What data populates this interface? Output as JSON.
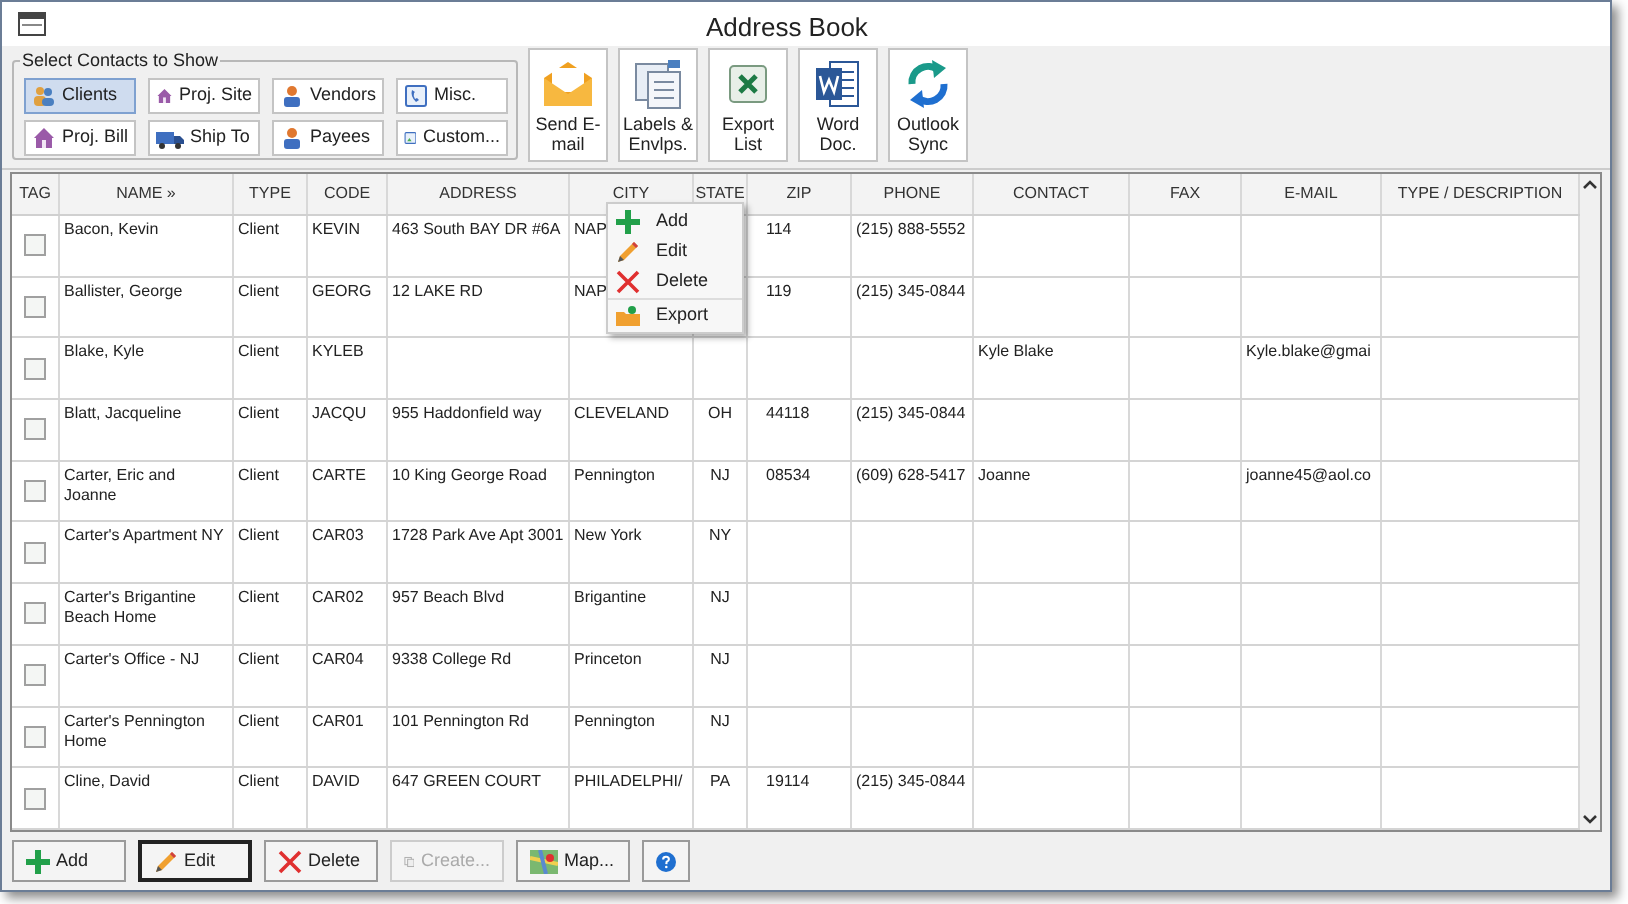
{
  "window": {
    "title": "Address Book"
  },
  "filter_group": {
    "title": "Select Contacts to Show",
    "options": [
      {
        "label": "Clients",
        "selected": true,
        "kind": "people"
      },
      {
        "label": "Proj. Site",
        "selected": false,
        "kind": "house"
      },
      {
        "label": "Vendors",
        "selected": false,
        "kind": "worker"
      },
      {
        "label": "Misc.",
        "selected": false,
        "kind": "phone"
      },
      {
        "label": "Proj. Bill",
        "selected": false,
        "kind": "house"
      },
      {
        "label": "Ship To",
        "selected": false,
        "kind": "truck"
      },
      {
        "label": "Payees",
        "selected": false,
        "kind": "worker"
      },
      {
        "label": "Custom...",
        "selected": false,
        "kind": "custom"
      }
    ]
  },
  "toolbar": [
    {
      "label": "Send E-mail",
      "kind": "mail"
    },
    {
      "label": "Labels & Envlps.",
      "kind": "labels"
    },
    {
      "label": "Export List",
      "kind": "sheet"
    },
    {
      "label": "Word Doc.",
      "kind": "doc"
    },
    {
      "label": "Outlook Sync",
      "kind": "sync"
    }
  ],
  "table": {
    "columns": [
      "TAG",
      "NAME »",
      "TYPE",
      "CODE",
      "ADDRESS",
      "CITY",
      "STATE",
      "ZIP",
      "PHONE",
      "CONTACT",
      "FAX",
      "E-MAIL",
      "TYPE / DESCRIPTION"
    ],
    "rows": [
      {
        "checked": false,
        "cells": [
          "",
          "Bacon, Kevin",
          "Client",
          "KEVIN",
          "463 South BAY DR #6A",
          "NAP",
          "",
          "114",
          "(215) 888-5552",
          "",
          "",
          "",
          ""
        ]
      },
      {
        "checked": false,
        "cells": [
          "",
          "Ballister, George",
          "Client",
          "GEORG",
          "12 LAKE RD",
          "NAP",
          "",
          "119",
          "(215) 345-0844",
          "",
          "",
          "",
          ""
        ]
      },
      {
        "checked": false,
        "cells": [
          "",
          "Blake, Kyle",
          "Client",
          "KYLEB",
          "",
          "",
          "",
          "",
          "",
          "Kyle Blake",
          "",
          "Kyle.blake@gmai",
          ""
        ]
      },
      {
        "checked": false,
        "cells": [
          "",
          "Blatt, Jacqueline",
          "Client",
          "JACQU",
          "955 Haddonfield way",
          "CLEVELAND",
          "OH",
          "44118",
          "(215) 345-0844",
          "",
          "",
          "",
          ""
        ]
      },
      {
        "checked": false,
        "cells": [
          "",
          "Carter, Eric and Joanne",
          "Client",
          "CARTE",
          "10 King George Road",
          "Pennington",
          "NJ",
          "08534",
          "(609) 628-5417",
          "Joanne",
          "",
          "joanne45@aol.co",
          ""
        ]
      },
      {
        "checked": false,
        "cells": [
          "",
          "Carter's Apartment NY",
          "Client",
          "CAR03",
          "1728 Park Ave Apt 3001",
          "New York",
          "NY",
          "",
          "",
          "",
          "",
          "",
          ""
        ]
      },
      {
        "checked": false,
        "cells": [
          "",
          "Carter's Brigantine Beach Home",
          "Client",
          "CAR02",
          "957 Beach Blvd",
          "Brigantine",
          "NJ",
          "",
          "",
          "",
          "",
          "",
          ""
        ]
      },
      {
        "checked": false,
        "cells": [
          "",
          "Carter's Office - NJ",
          "Client",
          "CAR04",
          "9338 College Rd",
          "Princeton",
          "NJ",
          "",
          "",
          "",
          "",
          "",
          ""
        ]
      },
      {
        "checked": false,
        "cells": [
          "",
          "Carter's Pennington Home",
          "Client",
          "CAR01",
          "101 Pennington Rd",
          "Pennington",
          "NJ",
          "",
          "",
          "",
          "",
          "",
          ""
        ]
      },
      {
        "checked": false,
        "cells": [
          "",
          "Cline, David",
          "Client",
          "DAVID",
          "647 GREEN COURT",
          "PHILADELPHI/",
          "PA",
          "19114",
          "(215) 345-0844",
          "",
          "",
          "",
          ""
        ]
      }
    ]
  },
  "context_menu": [
    {
      "label": "Add",
      "kind": "add"
    },
    {
      "label": "Edit",
      "kind": "edit"
    },
    {
      "label": "Delete",
      "kind": "delete"
    },
    {
      "label": "Export",
      "kind": "export"
    }
  ],
  "bottom_buttons": [
    {
      "label": "Add",
      "kind": "add",
      "disabled": false
    },
    {
      "label": "Edit",
      "kind": "edit",
      "disabled": false
    },
    {
      "label": "Delete",
      "kind": "delete",
      "disabled": false
    },
    {
      "label": "Create...",
      "kind": "create",
      "disabled": true
    },
    {
      "label": "Map...",
      "kind": "map",
      "disabled": false
    },
    {
      "kind": "help",
      "disabled": false
    }
  ]
}
